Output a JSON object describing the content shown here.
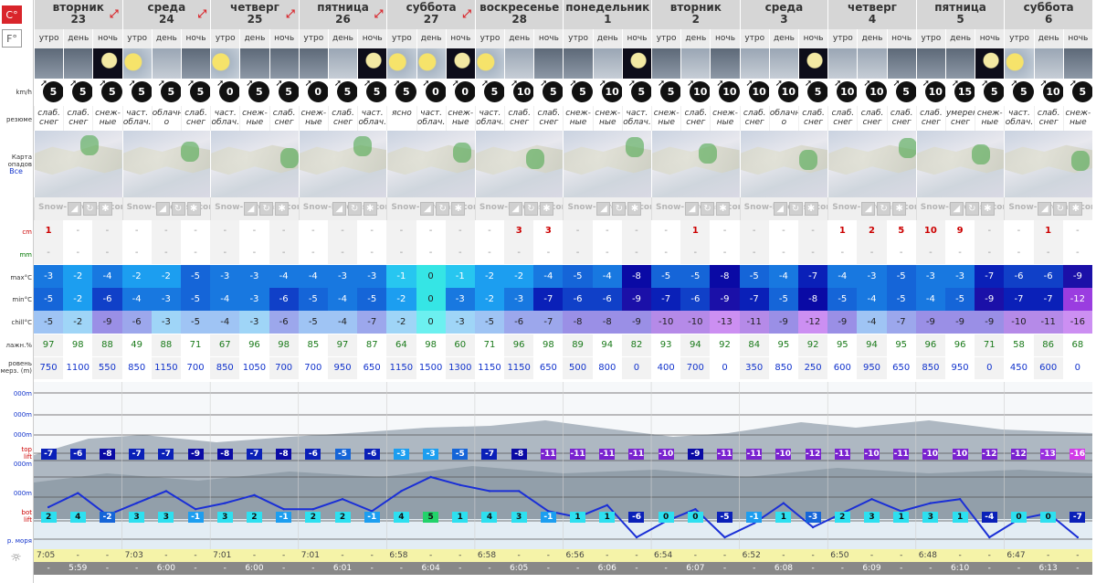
{
  "units": {
    "c": "C°",
    "f": "F°"
  },
  "labels": {
    "wind": "km/h",
    "summary": "резюме",
    "map_line1": "Карта",
    "map_line2": "опадов",
    "map_line3": "Все",
    "snow": "cm",
    "rain": "mm",
    "tmax": "max°C",
    "tmin": "min°C",
    "chill": "chill°C",
    "humidity": "лажн.%",
    "freezing1": "ровень",
    "freezing2": "мерз. (m)",
    "alt1": "000m",
    "alt2": "000m",
    "alt3": "000m",
    "alt4": "000m",
    "toplift1": "top",
    "toplift2": "lift",
    "alt5": "000m",
    "botlift1": "bot",
    "botlift2": "lift",
    "sea": "р. моря"
  },
  "map_watermark": "Snow-Forecast.com",
  "days": [
    {
      "name": "вторник",
      "num": "23",
      "arrow": true
    },
    {
      "name": "среда",
      "num": "24",
      "arrow": true
    },
    {
      "name": "четверг",
      "num": "25",
      "arrow": true
    },
    {
      "name": "пятница",
      "num": "26",
      "arrow": true
    },
    {
      "name": "суббота",
      "num": "27",
      "arrow": true
    },
    {
      "name": "воскресенье",
      "num": "28",
      "arrow": false
    },
    {
      "name": "понедельник",
      "num": "1",
      "arrow": false
    },
    {
      "name": "вторник",
      "num": "2",
      "arrow": false
    },
    {
      "name": "среда",
      "num": "3",
      "arrow": false
    },
    {
      "name": "четверг",
      "num": "4",
      "arrow": false
    },
    {
      "name": "пятница",
      "num": "5",
      "arrow": false
    },
    {
      "name": "суббота",
      "num": "6",
      "arrow": false
    }
  ],
  "periods": [
    "утро",
    "день",
    "ночь"
  ],
  "wind": [
    "5",
    "5",
    "5",
    "5",
    "5",
    "5",
    "0",
    "5",
    "5",
    "0",
    "5",
    "5",
    "5",
    "0",
    "0",
    "5",
    "10",
    "5",
    "5",
    "10",
    "5",
    "5",
    "10",
    "10",
    "10",
    "10",
    "5",
    "10",
    "10",
    "5",
    "10",
    "15",
    "5",
    "5",
    "10",
    "5"
  ],
  "summary": [
    [
      "слаб.",
      "снег"
    ],
    [
      "слаб.",
      "снег"
    ],
    [
      "снеж-",
      "ные"
    ],
    [
      "част.",
      "облач."
    ],
    [
      "облачн",
      "о"
    ],
    [
      "слаб.",
      "снег"
    ],
    [
      "част.",
      "облач."
    ],
    [
      "снеж-",
      "ные"
    ],
    [
      "слаб.",
      "снег"
    ],
    [
      "снеж-",
      "ные"
    ],
    [
      "слаб.",
      "снег"
    ],
    [
      "част.",
      "облач."
    ],
    [
      "ясно",
      ""
    ],
    [
      "част.",
      "облач."
    ],
    [
      "снеж-",
      "ные"
    ],
    [
      "част.",
      "облач."
    ],
    [
      "слаб.",
      "снег"
    ],
    [
      "слаб.",
      "снег"
    ],
    [
      "снеж-",
      "ные"
    ],
    [
      "снеж-",
      "ные"
    ],
    [
      "част.",
      "облач."
    ],
    [
      "снеж-",
      "ные"
    ],
    [
      "слаб.",
      "снег"
    ],
    [
      "снеж-",
      "ные"
    ],
    [
      "слаб.",
      "снег"
    ],
    [
      "облачн",
      "о"
    ],
    [
      "слаб.",
      "снег"
    ],
    [
      "слаб.",
      "снег"
    ],
    [
      "слаб.",
      "снег"
    ],
    [
      "слаб.",
      "снег"
    ],
    [
      "слаб.",
      "снег"
    ],
    [
      "умерен",
      "снег"
    ],
    [
      "снеж-",
      "ные"
    ],
    [
      "част.",
      "облач."
    ],
    [
      "слаб.",
      "снег"
    ],
    [
      "снеж-",
      "ные"
    ]
  ],
  "snow": [
    "1",
    "-",
    "-",
    "-",
    "-",
    "-",
    "-",
    "-",
    "-",
    "-",
    "-",
    "-",
    "-",
    "-",
    "-",
    "-",
    "3",
    "3",
    "-",
    "-",
    "-",
    "-",
    "1",
    "-",
    "-",
    "-",
    "-",
    "1",
    "2",
    "5",
    "10",
    "9",
    "-",
    "-",
    "1",
    "-"
  ],
  "rain": [
    "-",
    "-",
    "-",
    "-",
    "-",
    "-",
    "-",
    "-",
    "-",
    "-",
    "-",
    "-",
    "-",
    "-",
    "-",
    "-",
    "-",
    "-",
    "-",
    "-",
    "-",
    "-",
    "-",
    "-",
    "-",
    "-",
    "-",
    "-",
    "-",
    "-",
    "-",
    "-",
    "-",
    "-",
    "-",
    "-"
  ],
  "tmax": [
    "-3",
    "-2",
    "-4",
    "-2",
    "-2",
    "-5",
    "-3",
    "-3",
    "-4",
    "-4",
    "-3",
    "-3",
    "-1",
    "0",
    "-1",
    "-2",
    "-2",
    "-4",
    "-5",
    "-4",
    "-8",
    "-5",
    "-5",
    "-8",
    "-5",
    "-4",
    "-7",
    "-4",
    "-3",
    "-5",
    "-3",
    "-3",
    "-7",
    "-6",
    "-6",
    "-9"
  ],
  "tmin": [
    "-5",
    "-2",
    "-6",
    "-4",
    "-3",
    "-5",
    "-4",
    "-3",
    "-6",
    "-5",
    "-4",
    "-5",
    "-2",
    "0",
    "-3",
    "-2",
    "-3",
    "-7",
    "-6",
    "-6",
    "-9",
    "-7",
    "-6",
    "-9",
    "-7",
    "-5",
    "-8",
    "-5",
    "-4",
    "-5",
    "-4",
    "-5",
    "-9",
    "-7",
    "-7",
    "-12"
  ],
  "chill": [
    "-5",
    "-2",
    "-9",
    "-6",
    "-3",
    "-5",
    "-4",
    "-3",
    "-6",
    "-5",
    "-4",
    "-7",
    "-2",
    "0",
    "-3",
    "-5",
    "-6",
    "-7",
    "-8",
    "-8",
    "-9",
    "-10",
    "-10",
    "-13",
    "-11",
    "-9",
    "-12",
    "-9",
    "-4",
    "-7",
    "-9",
    "-9",
    "-9",
    "-10",
    "-11",
    "-16"
  ],
  "humidity": [
    "97",
    "98",
    "88",
    "49",
    "88",
    "71",
    "67",
    "96",
    "98",
    "85",
    "97",
    "87",
    "64",
    "98",
    "60",
    "71",
    "96",
    "98",
    "89",
    "94",
    "82",
    "93",
    "94",
    "92",
    "84",
    "95",
    "92",
    "95",
    "94",
    "95",
    "96",
    "96",
    "71",
    "58",
    "86",
    "68"
  ],
  "freezing": [
    "750",
    "1100",
    "550",
    "850",
    "1150",
    "700",
    "850",
    "1050",
    "700",
    "700",
    "950",
    "650",
    "1150",
    "1500",
    "1300",
    "1150",
    "1150",
    "650",
    "500",
    "800",
    "0",
    "400",
    "700",
    "0",
    "350",
    "850",
    "250",
    "600",
    "950",
    "650",
    "850",
    "950",
    "0",
    "450",
    "600",
    "0"
  ],
  "toplift": [
    "-7",
    "-6",
    "-8",
    "-7",
    "-7",
    "-9",
    "-8",
    "-7",
    "-8",
    "-6",
    "-5",
    "-6",
    "-3",
    "-3",
    "-5",
    "-7",
    "-8",
    "-11",
    "-11",
    "-11",
    "-11",
    "-10",
    "-9",
    "-11",
    "-11",
    "-10",
    "-12",
    "-11",
    "-10",
    "-11",
    "-10",
    "-10",
    "-12",
    "-12",
    "-13",
    "-16"
  ],
  "botlift": [
    "2",
    "4",
    "-2",
    "3",
    "3",
    "-1",
    "3",
    "2",
    "-1",
    "2",
    "2",
    "-1",
    "4",
    "5",
    "1",
    "4",
    "3",
    "-1",
    "1",
    "1",
    "-6",
    "0",
    "0",
    "-5",
    "-1",
    "1",
    "-3",
    "2",
    "3",
    "1",
    "3",
    "1",
    "-4",
    "0",
    "0",
    "-7"
  ],
  "sunrise": [
    "7:05",
    "7:03",
    "7:01",
    "7:01",
    "6:58",
    "6:58",
    "6:56",
    "6:54",
    "6:52",
    "6:50",
    "6:48",
    "6:47"
  ],
  "sunset": [
    "5:59",
    "6:00",
    "6:00",
    "6:01",
    "6:04",
    "6:05",
    "6:06",
    "6:07",
    "6:08",
    "6:09",
    "6:10",
    "6:13"
  ],
  "chart_data": {
    "type": "line",
    "series": [
      {
        "values": [
          750,
          1100,
          550,
          850,
          1150,
          700,
          850,
          1050,
          700,
          700,
          950,
          650,
          1150,
          1500,
          1300,
          1150,
          1150,
          650,
          500,
          800,
          0,
          400,
          700,
          0,
          350,
          850,
          250,
          600,
          950,
          650,
          850,
          950,
          0,
          450,
          600,
          0
        ]
      }
    ],
    "ylim": [
      0,
      2500
    ]
  },
  "colors": {
    "accent": "#d9252b",
    "line": "#1a2fd6"
  }
}
